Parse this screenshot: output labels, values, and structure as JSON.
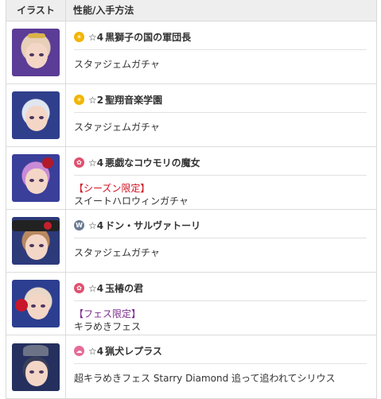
{
  "header": {
    "col1": "イラスト",
    "col2": "性能/入手方法"
  },
  "rows": [
    {
      "rarity": "☆4",
      "title": "黒獅子の国の軍団長",
      "tag": "",
      "method": "スタァジェムガチャ",
      "icon": "sun-icon",
      "icon_color": "#f2b400"
    },
    {
      "rarity": "☆2",
      "title": "聖翔音楽学園",
      "tag": "",
      "method": "スタァジェムガチャ",
      "icon": "sun-icon",
      "icon_color": "#f2b400"
    },
    {
      "rarity": "☆4",
      "title": "悪戯なコウモリの魔女",
      "tag": "【シーズン限定】",
      "method": "スイートハロウィンガチャ",
      "icon": "flower-icon",
      "icon_color": "#e0506e"
    },
    {
      "rarity": "☆4",
      "title": "ドン・サルヴァトーリ",
      "tag": "",
      "method": "スタァジェムガチャ",
      "icon": "wind-icon",
      "icon_color": "#6a7a93"
    },
    {
      "rarity": "☆4",
      "title": "玉椿の君",
      "tag": "【フェス限定】",
      "method": "キラめきフェス",
      "icon": "flower-icon",
      "icon_color": "#e0506e"
    },
    {
      "rarity": "☆4",
      "title": "猟犬レプラス",
      "tag": "",
      "method": "超キラめきフェス Starry Diamond 追って追われてシリウス",
      "icon": "cloud-icon",
      "icon_color": "#e46b9a"
    }
  ]
}
